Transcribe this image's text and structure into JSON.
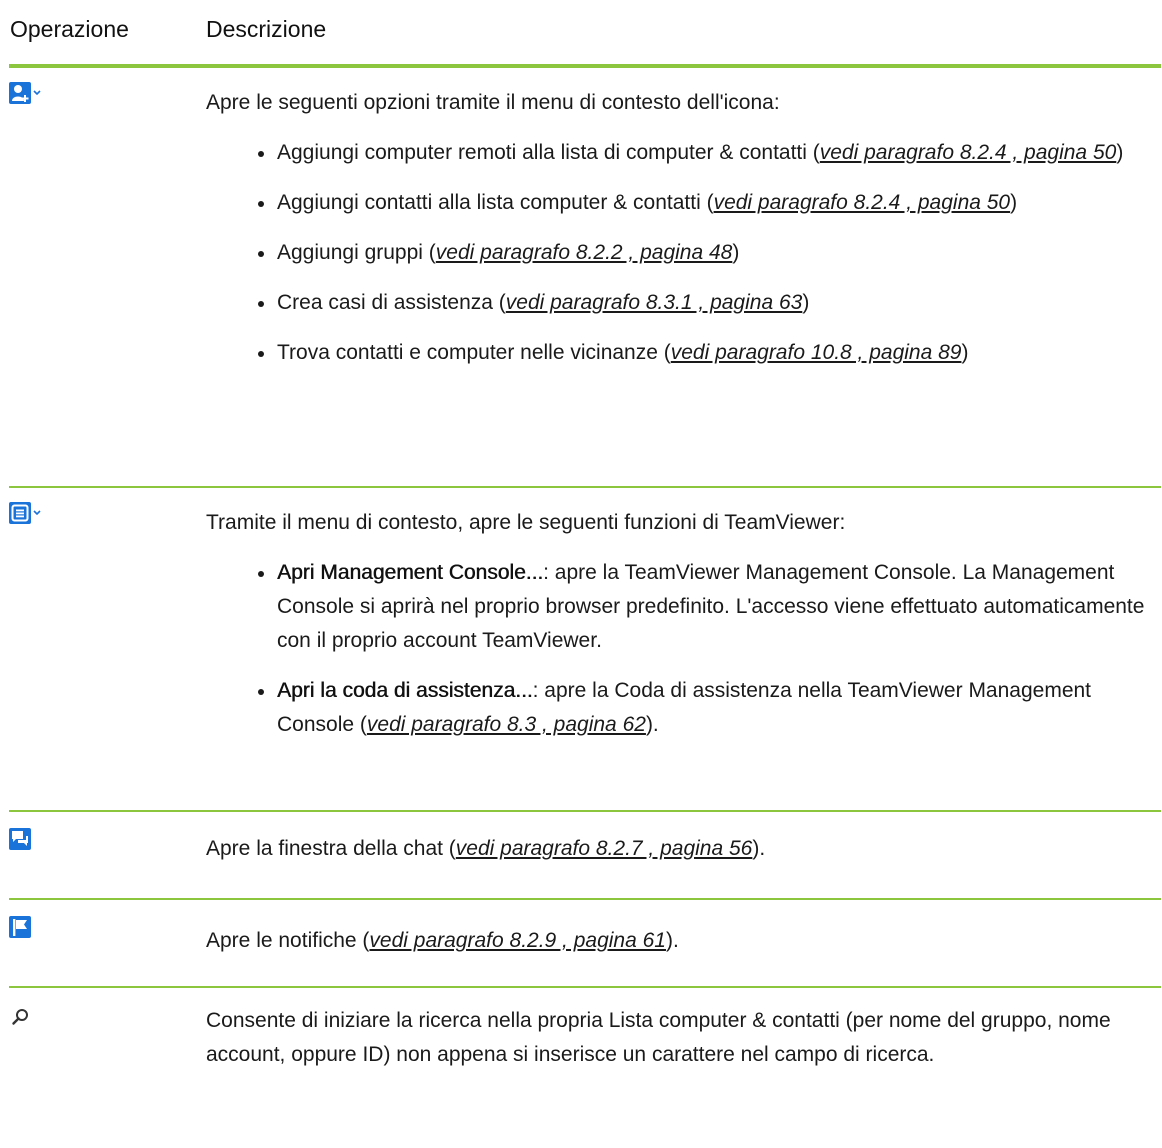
{
  "header": {
    "operation": "Operazione",
    "description": "Descrizione"
  },
  "colors": {
    "accent_line": "#8cc63f",
    "icon_blue": "#1a73d9"
  },
  "rows": [
    {
      "icon": "add-contact-icon",
      "intro": "Apre le seguenti opzioni tramite il menu di contesto dell'icona:",
      "items": [
        {
          "text": "Aggiungi computer remoti alla lista di computer & contatti (",
          "link": "vedi paragrafo 8.2.4 , pagina 50",
          "after": ")"
        },
        {
          "text": "Aggiungi contatti alla lista computer & contatti (",
          "link": "vedi paragrafo 8.2.4 , pagina 50",
          "after": ")"
        },
        {
          "text": "Aggiungi gruppi (",
          "link": "vedi paragrafo 8.2.2 , pagina 48",
          "after": ")"
        },
        {
          "text": "Crea casi di assistenza (",
          "link": "vedi paragrafo 8.3.1 , pagina 63",
          "after": ")"
        },
        {
          "text": "Trova contatti e computer nelle vicinanze (",
          "link": "vedi paragrafo 10.8 , pagina 89",
          "after": ")"
        }
      ]
    },
    {
      "icon": "menu-list-icon",
      "intro": "Tramite il menu di contesto, apre le seguenti funzioni di TeamViewer:",
      "items": [
        {
          "bold": "Apri Management Console...",
          "text": ": apre la TeamViewer Management Console. La Management Console si aprirà nel proprio browser predefinito. L'accesso viene effettuato automaticamente con il proprio account TeamViewer."
        },
        {
          "bold": "Apri la coda di assistenza...",
          "text": ": apre la Coda di assistenza nella TeamViewer Management Console (",
          "link": "vedi paragrafo 8.3 , pagina 62",
          "after": ")."
        }
      ]
    },
    {
      "icon": "chat-icon",
      "text": "Apre la finestra della chat (",
      "link": "vedi paragrafo 8.2.7 , pagina 56",
      "after": ")."
    },
    {
      "icon": "flag-icon",
      "text": "Apre le notifiche (",
      "link": "vedi paragrafo 8.2.9 , pagina 61",
      "after": ")."
    },
    {
      "icon": "search-icon",
      "text": "Consente di iniziare la ricerca nella propria Lista computer & contatti (per nome del gruppo, nome account, oppure ID) non appena si inserisce un carattere nel campo di ricerca."
    }
  ]
}
